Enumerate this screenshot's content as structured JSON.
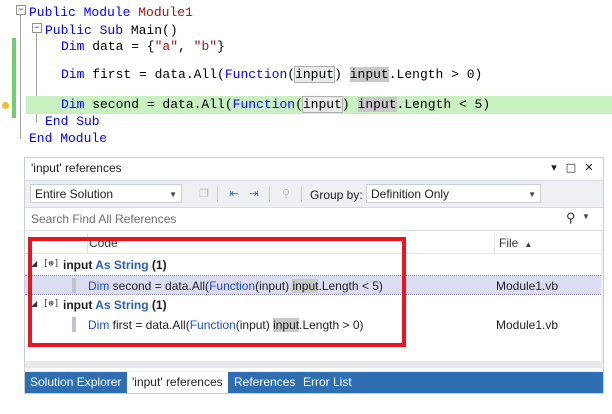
{
  "editor": {
    "lines": {
      "l1": {
        "kw": "Public Module",
        "name": "Module1"
      },
      "l2": {
        "kw": "Public Sub",
        "rest": " Main()"
      },
      "l3": {
        "kw": "Dim",
        "a": " data = {",
        "s1": "\"a\"",
        "c": ", ",
        "s2": "\"b\"",
        "e": "}"
      },
      "l4": {
        "kw": "Dim",
        "a": " first = data.All(",
        "fn": "Function",
        "p1": "(",
        "param": "input",
        "p2": ")",
        "sp": " ",
        "ref": "input",
        "tail": ".Length > 0)"
      },
      "l5": {
        "kw": "Dim",
        "a": " second = data.All(",
        "fn": "Function",
        "p1": "(",
        "param": "input",
        "p2": ")",
        "sp": " ",
        "ref": "input",
        "tail": ".Length < 5)"
      },
      "l6": {
        "kw": "End Sub"
      },
      "l7": {
        "kw": "End Module"
      }
    },
    "fold_glyph": "−"
  },
  "panel": {
    "title": "'input' references",
    "title_buttons": {
      "dropdown": "▾",
      "maximize": "□",
      "close": "✕"
    },
    "toolbar": {
      "scope": "Entire Solution",
      "groupby_label": "Group by:",
      "groupby_value": "Definition Only"
    },
    "search_placeholder": "Search Find All References",
    "columns": {
      "code": "Code",
      "file": "File",
      "sort_glyph": "▲"
    },
    "groups": [
      {
        "name": "input",
        "as": "As String",
        "count": "(1)",
        "rows": [
          {
            "k": "Dim",
            "pre": " second = data.All(",
            "fn": "Function",
            "mid": "(input) ",
            "hl": "input",
            "post": ".Length < 5)",
            "file": "Module1.vb",
            "selected": true
          }
        ]
      },
      {
        "name": "input",
        "as": "As String",
        "count": "(1)",
        "rows": [
          {
            "k": "Dim",
            "pre": " first = data.All(",
            "fn": "Function",
            "mid": "(input) ",
            "hl": "input",
            "post": ".Length > 0)",
            "file": "Module1.vb",
            "selected": false
          }
        ]
      }
    ],
    "tabs": [
      "Solution Explorer",
      "'input' references",
      "References",
      "Error List"
    ],
    "active_tab": "'input' references"
  },
  "colors": {
    "accent": "#2e6fb4",
    "highlight_line": "#c8f0c0",
    "red_box": "#e8141f"
  }
}
